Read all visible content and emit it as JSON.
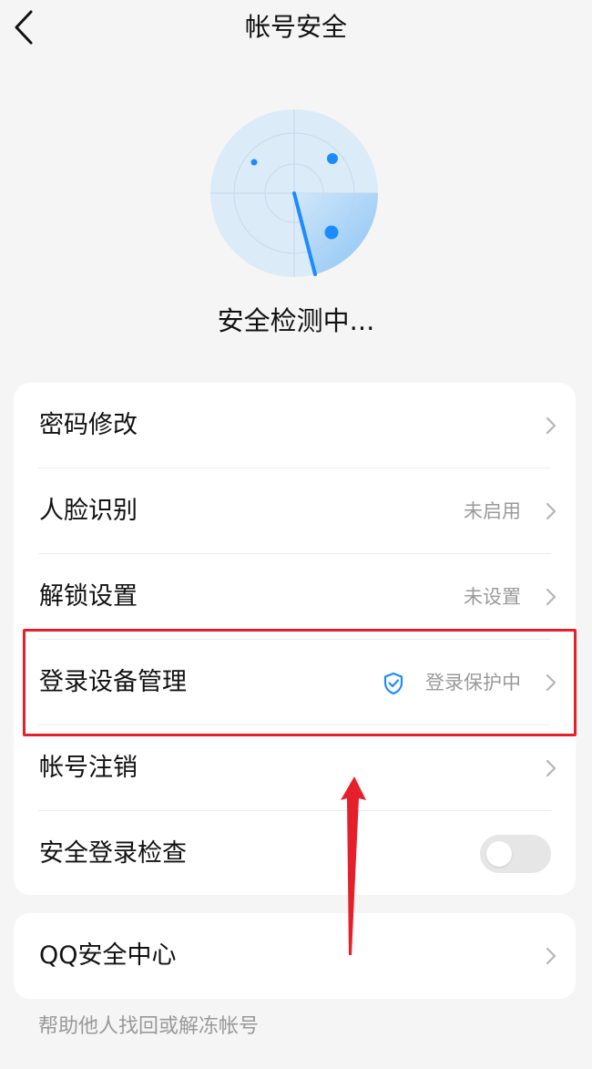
{
  "header": {
    "title": "帐号安全",
    "back_icon": "chevron-left-icon"
  },
  "scan": {
    "status": "安全检测中..."
  },
  "settings": {
    "items": [
      {
        "label": "密码修改",
        "value": ""
      },
      {
        "label": "人脸识别",
        "value": "未启用"
      },
      {
        "label": "解锁设置",
        "value": "未设置"
      },
      {
        "label": "登录设备管理",
        "value": "登录保护中",
        "icon": "shield-check-icon"
      },
      {
        "label": "帐号注销",
        "value": ""
      },
      {
        "label": "安全登录检查",
        "toggle_on": false
      }
    ]
  },
  "qq": {
    "label": "QQ安全中心"
  },
  "footer": {
    "help_link": "帮助他人找回或解冻帐号"
  },
  "colors": {
    "accent": "#1a8cff",
    "annotation": "#e6202a",
    "background": "#f5f5f5",
    "card": "#ffffff"
  }
}
